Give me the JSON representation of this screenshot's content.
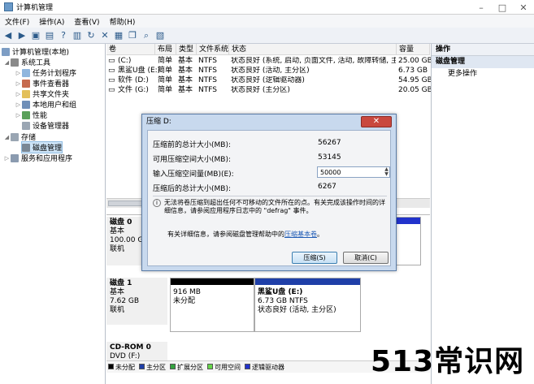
{
  "window": {
    "title": "计算机管理"
  },
  "menu": [
    "文件(F)",
    "操作(A)",
    "查看(V)",
    "帮助(H)"
  ],
  "tree": {
    "root": "计算机管理(本地)",
    "system_tools": "系统工具",
    "items": [
      "任务计划程序",
      "事件查看器",
      "共享文件夹",
      "本地用户和组",
      "性能",
      "设备管理器"
    ],
    "storage": "存储",
    "disk_mgmt": "磁盘管理",
    "services": "服务和应用程序"
  },
  "volumes": {
    "headers": [
      "卷",
      "布局",
      "类型",
      "文件系统",
      "状态",
      "容量"
    ],
    "rows": [
      {
        "vol": "(C:)",
        "layout": "简单",
        "type": "基本",
        "fs": "NTFS",
        "status": "状态良好 (系统, 启动, 页面文件, 活动, 故障转储, 主分区)",
        "cap": "25.00 GB"
      },
      {
        "vol": "黑鲨U盘 (E:)",
        "layout": "简单",
        "type": "基本",
        "fs": "NTFS",
        "status": "状态良好 (活动, 主分区)",
        "cap": "6.73 GB"
      },
      {
        "vol": "软件 (D:)",
        "layout": "简单",
        "type": "基本",
        "fs": "NTFS",
        "status": "状态良好 (逻辑驱动器)",
        "cap": "54.95 GB"
      },
      {
        "vol": "文件 (G:)",
        "layout": "简单",
        "type": "基本",
        "fs": "NTFS",
        "status": "状态良好 (主分区)",
        "cap": "20.05 GB"
      }
    ]
  },
  "disks": {
    "disk0": {
      "name": "磁盘 0",
      "type": "基本",
      "size": "100.00 GB",
      "state": "联机"
    },
    "disk1": {
      "name": "磁盘 1",
      "type": "基本",
      "size": "7.62 GB",
      "state": "联机",
      "unalloc_size": "916 MB",
      "unalloc_label": "未分配",
      "part_name": "黑鲨U盘 (E:)",
      "part_size": "6.73 GB NTFS",
      "part_status": "状态良好 (活动, 主分区)"
    },
    "cdrom": {
      "name": "CD-ROM 0",
      "type": "DVD (F:)"
    }
  },
  "legend": [
    "未分配",
    "主分区",
    "扩展分区",
    "可用空间",
    "逻辑驱动器"
  ],
  "actions": {
    "header": "操作",
    "section": "磁盘管理",
    "more": "更多操作"
  },
  "dialog": {
    "title": "压缩 D:",
    "close": "✕",
    "rows": [
      {
        "label": "压缩前的总计大小(MB):",
        "value": "56267"
      },
      {
        "label": "可用压缩空间大小(MB):",
        "value": "53145"
      },
      {
        "label": "输入压缩空间量(MB)(E):",
        "value": "50000"
      },
      {
        "label": "压缩后的总计大小(MB):",
        "value": "6267"
      }
    ],
    "info": "无法将卷压缩到超出任何不可移动的文件所在的点。有关完成该操作时间的详细信息，请参阅应用程序日志中的 \"defrag\" 事件。",
    "help_prefix": "有关详细信息，请参阅磁盘管理帮助中的",
    "help_link": "压缩基本卷",
    "ok": "压缩(S)",
    "cancel": "取消(C)"
  },
  "watermark": "513常识网",
  "colors": {
    "unalloc": "#000000",
    "primary": "#1f3fa8",
    "extended": "#33a33f",
    "free": "#66d64a",
    "logical": "#2233cc"
  }
}
